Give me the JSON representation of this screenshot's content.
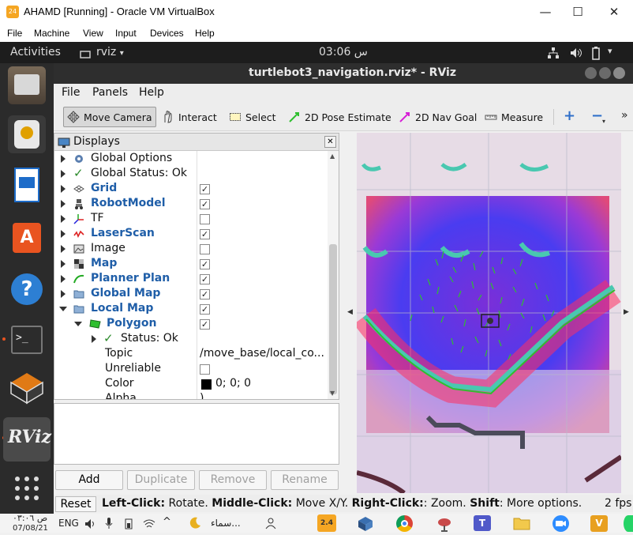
{
  "vbox": {
    "title": "AHAMD [Running] - Oracle VM VirtualBox",
    "menu": [
      "File",
      "Machine",
      "View",
      "Input",
      "Devices",
      "Help"
    ],
    "controls": {
      "minimize": "—",
      "maximize": "☐",
      "close": "✕"
    }
  },
  "ubuntu": {
    "activities": "Activities",
    "app": "rviz",
    "clock": "03:06 س"
  },
  "rviz": {
    "title": "turtlebot3_navigation.rviz* - RViz",
    "menu": [
      "File",
      "Panels",
      "Help"
    ],
    "tools": {
      "move_camera": "Move Camera",
      "interact": "Interact",
      "select": "Select",
      "pose_estimate": "2D Pose Estimate",
      "nav_goal": "2D Nav Goal",
      "measure": "Measure",
      "overflow": "»"
    },
    "displays_title": "Displays",
    "displays_close": "✕",
    "rows": [
      {
        "label": "Global Options",
        "check": ""
      },
      {
        "label": "Global Status: Ok",
        "check": ""
      },
      {
        "label": "Grid",
        "check": "✓"
      },
      {
        "label": "RobotModel",
        "check": "✓"
      },
      {
        "label": "TF",
        "check": ""
      },
      {
        "label": "LaserScan",
        "check": "✓"
      },
      {
        "label": "Image",
        "check": ""
      },
      {
        "label": "Map",
        "check": "✓"
      },
      {
        "label": "Planner Plan",
        "check": "✓"
      },
      {
        "label": "Global Map",
        "check": "✓"
      },
      {
        "label": "Local Map",
        "check": "✓"
      },
      {
        "label": "Polygon",
        "check": "✓"
      },
      {
        "label": "Status: Ok",
        "value": ""
      },
      {
        "label": "Topic",
        "value": "/move_base/local_co..."
      },
      {
        "label": "Unreliable",
        "check": ""
      },
      {
        "label": "Color",
        "value": "0; 0; 0"
      },
      {
        "label": "Alpha",
        "value": ")"
      }
    ],
    "buttons": {
      "add": "Add",
      "duplicate": "Duplicate",
      "remove": "Remove",
      "rename": "Rename",
      "reset": "Reset"
    },
    "status": {
      "b1": "Left-Click:",
      "t1": " Rotate. ",
      "b2": "Middle-Click:",
      "t2": " Move X/Y. ",
      "b3": "Right-Click:",
      "t3": ": Zoom. ",
      "b4": "Shift",
      "t4": ": More options.",
      "fps": "2 fps"
    }
  },
  "taskbar": {
    "time": "ص ٠٣:٠٦",
    "date": "07/08/21",
    "lang": "ENG",
    "weather": "سماء...",
    "badge": "2.4"
  },
  "colors": {
    "highlight": "#1f5ea8",
    "topbar": "#1d1d1d",
    "dock": "#2b2b2b",
    "green": "#2fbf2f"
  }
}
